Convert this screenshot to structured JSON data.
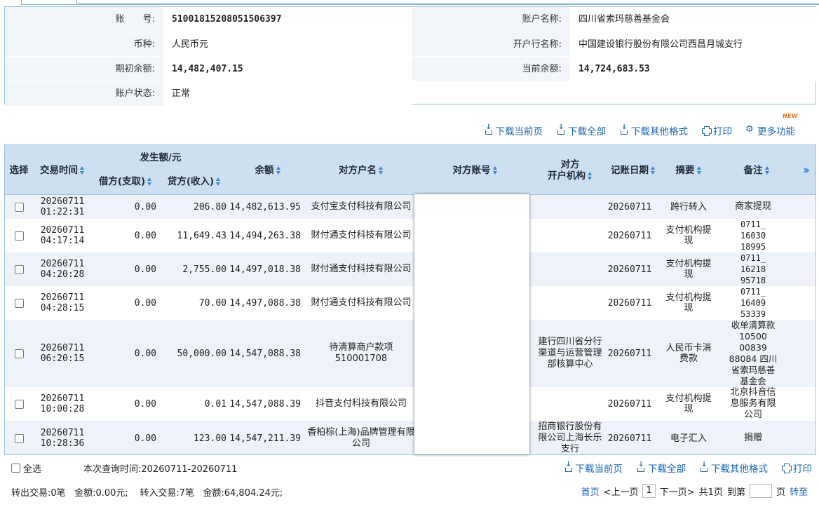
{
  "account": {
    "labels": {
      "account_no": "账　　号:",
      "currency": "币种:",
      "opening_balance": "期初余额:",
      "status": "账户状态:",
      "account_name": "账户名称:",
      "bank_name": "开户行名称:",
      "current_balance": "当前余额:"
    },
    "account_no": "51001815208051506397",
    "currency": "人民币元",
    "opening_balance": "14,482,407.15",
    "status": "正常",
    "account_name": "四川省索玛慈善基金会",
    "bank_name": "中国建设银行股份有限公司西昌月城支行",
    "current_balance": "14,724,683.53"
  },
  "toolbar": {
    "download_page": "下载当前页",
    "download_all": "下载全部",
    "download_other": "下载其他格式",
    "print": "打印",
    "more": "更多功能",
    "new_badge": "NEW"
  },
  "table": {
    "headers": {
      "select": "选择",
      "time": "交易时间",
      "amount_group": "发生额/元",
      "debit": "借方(支取)",
      "credit": "贷方(收入)",
      "balance": "余额",
      "counterparty_name": "对方户名",
      "counterparty_account": "对方账号",
      "counterparty_institution_1": "对方",
      "counterparty_institution_2": "开户机构",
      "posting_date": "记账日期",
      "summary": "摘要",
      "remark": "备注",
      "more": "»"
    },
    "rows": [
      {
        "date": "20260711",
        "time": "01:22:31",
        "debit": "0.00",
        "credit": "206.80",
        "balance": "14,482,613.95",
        "name": "支付宝支付科技有限公司",
        "institution": "",
        "posting_date": "20260711",
        "summary": "跨行转入",
        "remark": "商家提现"
      },
      {
        "date": "20260711",
        "time": "04:17:14",
        "debit": "0.00",
        "credit": "11,649.43",
        "balance": "14,494,263.38",
        "name": "财付通支付科技有限公司",
        "institution": "",
        "posting_date": "20260711",
        "summary": "支付机构提现",
        "remark": "0711_ 16030 18995"
      },
      {
        "date": "20260711",
        "time": "04:20:28",
        "debit": "0.00",
        "credit": "2,755.00",
        "balance": "14,497,018.38",
        "name": "财付通支付科技有限公司",
        "institution": "",
        "posting_date": "20260711",
        "summary": "支付机构提现",
        "remark": "0711_ 16218 95718"
      },
      {
        "date": "20260711",
        "time": "04:28:15",
        "debit": "0.00",
        "credit": "70.00",
        "balance": "14,497,088.38",
        "name": "财付通支付科技有限公司",
        "institution": "",
        "posting_date": "20260711",
        "summary": "支付机构提现",
        "remark": "0711_ 16409 53339"
      },
      {
        "date": "20260711",
        "time": "06:20:15",
        "debit": "0.00",
        "credit": "50,000.00",
        "balance": "14,547,088.38",
        "name": "待清算商户款项510001708",
        "institution": "建行四川省分行渠道与运营管理部核算中心",
        "posting_date": "20260711",
        "summary": "人民币卡消费款",
        "remark": "收单清算款 10500 00839 88084 四川省索玛慈善基金会"
      },
      {
        "date": "20260711",
        "time": "10:00:28",
        "debit": "0.00",
        "credit": "0.01",
        "balance": "14,547,088.39",
        "name": "抖音支付科技有限公司",
        "institution": "",
        "posting_date": "20260711",
        "summary": "支付机构提现",
        "remark": "北京抖音信息服务有限公司"
      },
      {
        "date": "20260711",
        "time": "10:28:36",
        "debit": "0.00",
        "credit": "123.00",
        "balance": "14,547,211.39",
        "name": "香柏棕(上海)品牌管理有限公司",
        "institution": "招商银行股份有限公司上海长乐支行",
        "posting_date": "20260711",
        "summary": "电子汇入",
        "remark": "捐赠"
      }
    ]
  },
  "footer": {
    "select_all": "全选",
    "query_time": "本次查询时间:20260711-20260711",
    "stats": {
      "out_label": "转出交易:0笔",
      "out_amount": "金额:0.00元;",
      "in_label": "转入交易:7笔",
      "in_amount": "金额:64,804.24元;"
    },
    "pager": {
      "first": "首页",
      "prev": "<上一页",
      "current": "1",
      "next": "下一页>",
      "total": "共1页",
      "goto": "到第",
      "page_unit": "页",
      "jump": "转至"
    }
  }
}
